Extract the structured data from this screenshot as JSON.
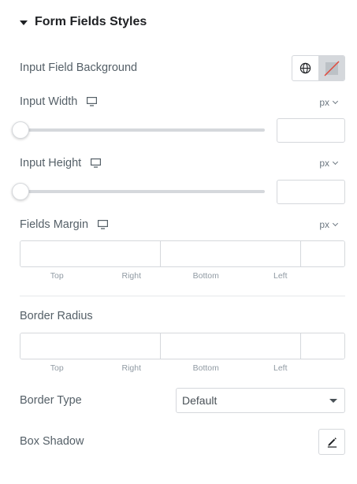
{
  "section": {
    "title": "Form Fields Styles"
  },
  "background": {
    "label": "Input Field Background"
  },
  "input_width": {
    "label": "Input Width",
    "unit": "px",
    "value": "",
    "slider_value": 0
  },
  "input_height": {
    "label": "Input Height",
    "unit": "px",
    "value": "",
    "slider_value": 0
  },
  "fields_margin": {
    "label": "Fields Margin",
    "unit": "px",
    "sides": [
      "Top",
      "Right",
      "Bottom",
      "Left"
    ]
  },
  "border_radius": {
    "label": "Border Radius",
    "sides": [
      "Top",
      "Right",
      "Bottom",
      "Left"
    ]
  },
  "border_type": {
    "label": "Border Type",
    "selected": "Default"
  },
  "box_shadow": {
    "label": "Box Shadow"
  },
  "icons": {
    "section_toggle": "caret-down-icon",
    "global": "globe-icon",
    "no_color": "no-color-swatch-icon",
    "responsive": "desktop-icon",
    "link": "link-icon",
    "edit": "pencil-icon"
  },
  "colors": {
    "text": "#556068",
    "border": "#d5d8dc",
    "heading": "#1f2124"
  }
}
